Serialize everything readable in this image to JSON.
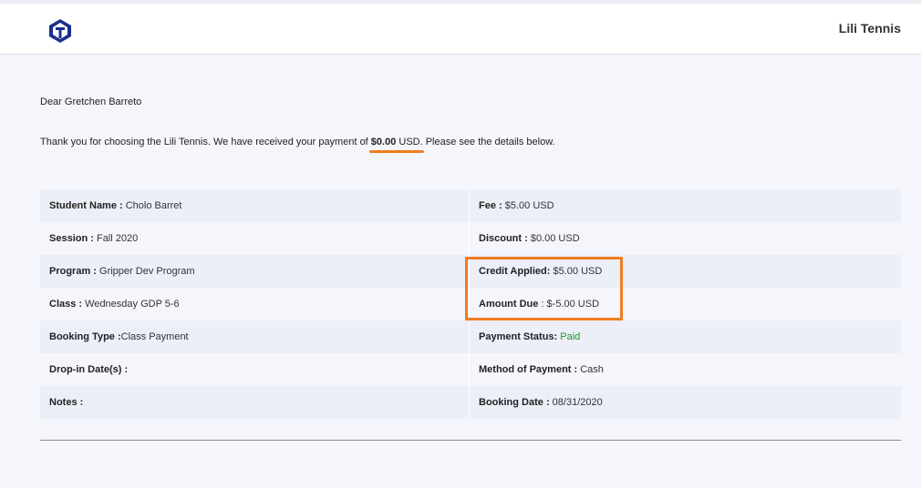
{
  "header": {
    "logo_icon": "lili-tennis-logo-icon",
    "brand": "Lili Tennis",
    "accent_color": "#1c2e8c"
  },
  "email": {
    "greeting": "Dear Gretchen Barreto",
    "message_before": "Thank you for choosing the Lili Tennis. We have received your payment of ",
    "amount": "$0.00",
    "currency": " USD",
    "message_after": ". Please see the details below."
  },
  "details": {
    "rows": [
      {
        "left_label": "Student Name : ",
        "left_value": "Cholo Barret",
        "right_label": "Fee : ",
        "right_value": "$5.00 USD"
      },
      {
        "left_label": "Session : ",
        "left_value": "Fall 2020",
        "right_label": "Discount : ",
        "right_value": "$0.00 USD"
      },
      {
        "left_label": "Program : ",
        "left_value": "Gripper Dev Program",
        "right_label": "Credit Applied: ",
        "right_value": "$5.00 USD"
      },
      {
        "left_label": "Class : ",
        "left_value": "Wednesday GDP 5-6",
        "right_label": "Amount Due",
        "right_value": " : $-5.00 USD"
      },
      {
        "left_label": "Booking Type :",
        "left_value": "Class Payment",
        "right_label": "Payment Status: ",
        "right_value": "Paid"
      },
      {
        "left_label": "Drop-in Date(s) :",
        "left_value": "",
        "right_label": "Method of Payment : ",
        "right_value": "Cash"
      },
      {
        "left_label": "Notes :",
        "left_value": "",
        "right_label": "Booking Date : ",
        "right_value": "08/31/2020"
      }
    ],
    "paid_color": "#1a9a2a",
    "highlight_color": "#f07d20"
  }
}
